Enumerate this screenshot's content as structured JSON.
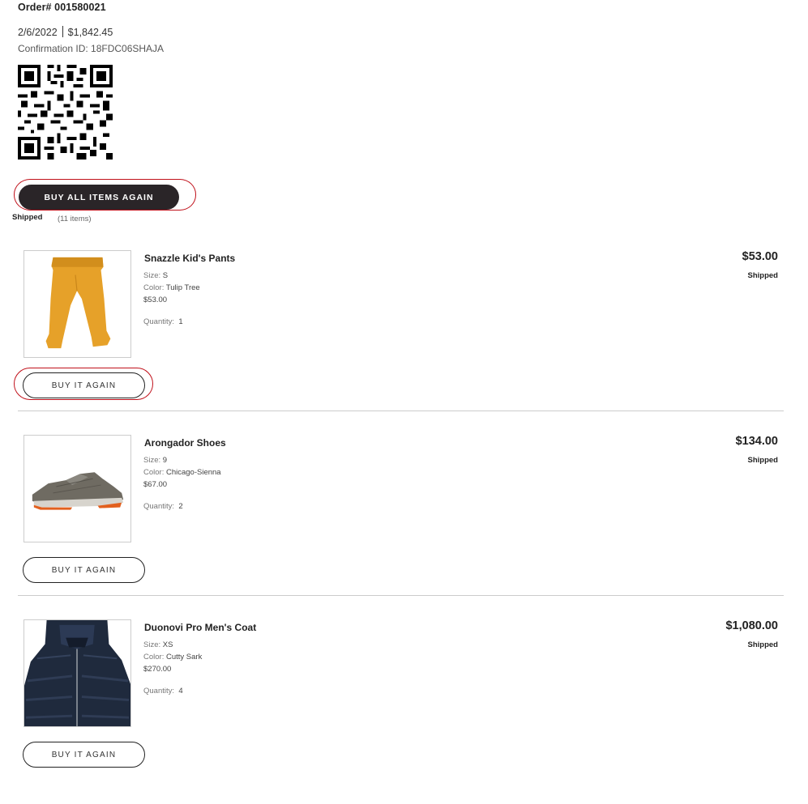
{
  "order": {
    "number": "Order# 001580021",
    "date": "2/6/2022",
    "total": "$1,842.45",
    "confirmation": "Confirmation ID: 18FDC06SHAJA",
    "buy_all_label": "BUY ALL ITEMS AGAIN",
    "shipment_status": "Shipped",
    "shipment_count": "(11 items)"
  },
  "items": [
    {
      "name": "Snazzle Kid's Pants",
      "size_label": "Size:",
      "size": "S",
      "color_label": "Color:",
      "color": "Tulip Tree",
      "unit_price": "$53.00",
      "qty_label": "Quantity:",
      "qty": "1",
      "line_total": "$53.00",
      "status": "Shipped",
      "button": "BUY IT AGAIN",
      "icon": "pants-image"
    },
    {
      "name": "Arongador Shoes",
      "size_label": "Size:",
      "size": "9",
      "color_label": "Color:",
      "color": "Chicago-Sienna",
      "unit_price": "$67.00",
      "qty_label": "Quantity:",
      "qty": "2",
      "line_total": "$134.00",
      "status": "Shipped",
      "button": "BUY IT AGAIN",
      "icon": "shoe-image"
    },
    {
      "name": "Duonovi Pro Men's Coat",
      "size_label": "Size:",
      "size": "XS",
      "color_label": "Color:",
      "color": "Cutty Sark",
      "unit_price": "$270.00",
      "qty_label": "Quantity:",
      "qty": "4",
      "line_total": "$1,080.00",
      "status": "Shipped",
      "button": "BUY IT AGAIN",
      "icon": "coat-image"
    }
  ],
  "colors": {
    "primary_button_bg": "#2a2528",
    "highlight_ring": "#c0101a",
    "divider": "#cccccc"
  }
}
